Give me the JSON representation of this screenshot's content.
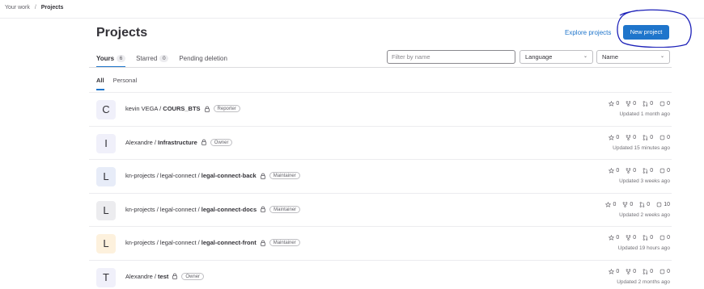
{
  "breadcrumb": {
    "root": "Your work",
    "separator": "/",
    "current": "Projects"
  },
  "header": {
    "title": "Projects",
    "explore_label": "Explore projects",
    "new_project_label": "New project",
    "annotation_color": "#1b1fb8"
  },
  "tabs": [
    {
      "label": "Yours",
      "count": "6"
    },
    {
      "label": "Starred",
      "count": "0"
    },
    {
      "label": "Pending deletion"
    }
  ],
  "filter": {
    "placeholder": "Filter by name",
    "language": "Language",
    "sort": "Name"
  },
  "subtabs": [
    {
      "label": "All"
    },
    {
      "label": "Personal"
    }
  ],
  "projects": [
    {
      "avatar_letter": "C",
      "avatar_color": "#f0f0fa",
      "namespace": "kevin VEGA / ",
      "name": "COURS_BTS",
      "role": "Reporter",
      "stars": "0",
      "forks": "0",
      "merge_requests": "0",
      "issues": "0",
      "updated": "Updated 1 month ago"
    },
    {
      "avatar_letter": "I",
      "avatar_color": "#f0f0fa",
      "namespace": "Alexandre / ",
      "name": "Infrastructure",
      "role": "Owner",
      "stars": "0",
      "forks": "0",
      "merge_requests": "0",
      "issues": "0",
      "updated": "Updated 15 minutes ago"
    },
    {
      "avatar_letter": "L",
      "avatar_color": "#e7ecf8",
      "namespace": "kn-projects / legal-connect / ",
      "name": "legal-connect-back",
      "role": "Maintainer",
      "stars": "0",
      "forks": "0",
      "merge_requests": "0",
      "issues": "0",
      "updated": "Updated 3 weeks ago"
    },
    {
      "avatar_letter": "L",
      "avatar_color": "#ececef",
      "namespace": "kn-projects / legal-connect / ",
      "name": "legal-connect-docs",
      "role": "Maintainer",
      "stars": "0",
      "forks": "0",
      "merge_requests": "0",
      "issues": "10",
      "updated": "Updated 2 weeks ago"
    },
    {
      "avatar_letter": "L",
      "avatar_color": "#fdf1dd",
      "namespace": "kn-projects / legal-connect / ",
      "name": "legal-connect-front",
      "role": "Maintainer",
      "stars": "0",
      "forks": "0",
      "merge_requests": "0",
      "issues": "0",
      "updated": "Updated 19 hours ago"
    },
    {
      "avatar_letter": "T",
      "avatar_color": "#f0f0fa",
      "namespace": "Alexandre / ",
      "name": "test",
      "role": "Owner",
      "stars": "0",
      "forks": "0",
      "merge_requests": "0",
      "issues": "0",
      "updated": "Updated 2 months ago"
    }
  ]
}
